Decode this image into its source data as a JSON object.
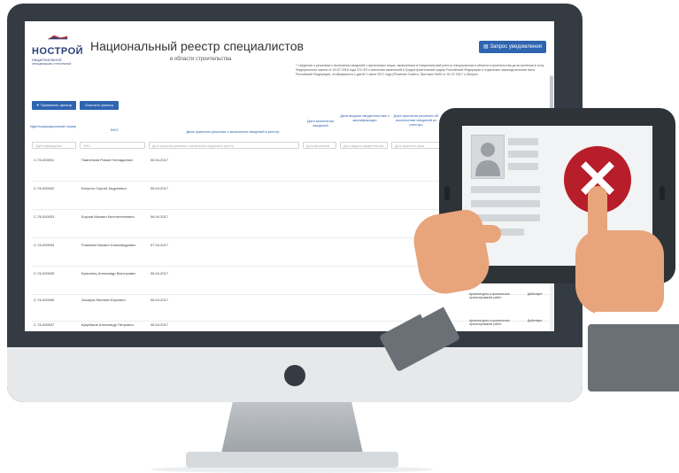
{
  "app": {
    "logo_main": "НОСТРОЙ",
    "logo_sub": "НАЦИОНАЛЬНОЕ",
    "logo_sub2": "ОБЪЕДИНЕНИЕ СТРОИТЕЛЕЙ",
    "title": "Национальный реестр специалистов",
    "subtitle": "в области строительства",
    "request_button": "Запрос уведомления",
    "note": "* Сведения о решениях о включении сведений о физических лицах, включенных в Национальный реестр специалистов в области строительства до вступления в силу Федерального закона от 03.07.2016 года 372-ФЗ о внесении изменений в Градостроительный кодекс Российской Федерации и отдельные законодательные акты Российской Федерации, отображаются с датой 1 июля 2017 года (Решение Совета, Протокол №95 от 01.07.2017 г.) Вопрос"
  },
  "filters": {
    "apply_label": "Применить фильтр",
    "clear_label": "Очистить фильтр",
    "id_placeholder": "Идентификационн",
    "fio_placeholder": "ФИО",
    "date_placeholder": "Дата принятия решения о включении сведений в реестр",
    "type_placeholder": "Дата включения",
    "cert_placeholder": "Дата выдачи свидетельства",
    "excl_placeholder": "Дата принятия реше"
  },
  "table": {
    "headers": {
      "id": "Идентификационный номер",
      "fio": "ФИО",
      "decision_date": "Дата принятия решения о включении сведений в реестр",
      "included_date": "Дата включения сведений",
      "cert_date": "Дата выдачи свидетельства о квалификации",
      "excluded_date": "Дата принятия решения об исключении сведений из реестра"
    },
    "rows": [
      {
        "id": "С-76-000001",
        "fio": "Павленков Роман Геннадьевич",
        "date": "06.04.2017"
      },
      {
        "id": "С-76-000002",
        "fio": "Белугин Сергей Андреевич",
        "date": "06.04.2017"
      },
      {
        "id": "С-76-000003",
        "fio": "Борзов Михаил Константинович",
        "date": "06.04.2017"
      },
      {
        "id": "С-76-000004",
        "fio": "Романов Михаил Александрович",
        "date": "07.04.2017"
      },
      {
        "id": "С-76-000005",
        "fio": "Брагинец Александр Викторович",
        "date": "06.04.2017"
      },
      {
        "id": "С-76-000006",
        "fio": "Захаров Евгений Юрьевич",
        "date": "06.04.2017"
      },
      {
        "id": "С-76-000007",
        "fio": "Щербаков Александр Петрович",
        "date": "06.04.2017"
      }
    ],
    "side_rows": [
      {
        "text": "Архитектурно-строительное проектирование работ",
        "status": "Действует"
      },
      {
        "text": "Архитектурно-строительное проектирование работ",
        "status": "Действует"
      }
    ]
  },
  "colors": {
    "accent": "#2f64b0",
    "reject": "#b81d2a",
    "monitor": "#353b42"
  },
  "icons": {
    "reject": "close-icon",
    "person": "user-icon",
    "request": "document-icon",
    "filter": "funnel-icon"
  }
}
